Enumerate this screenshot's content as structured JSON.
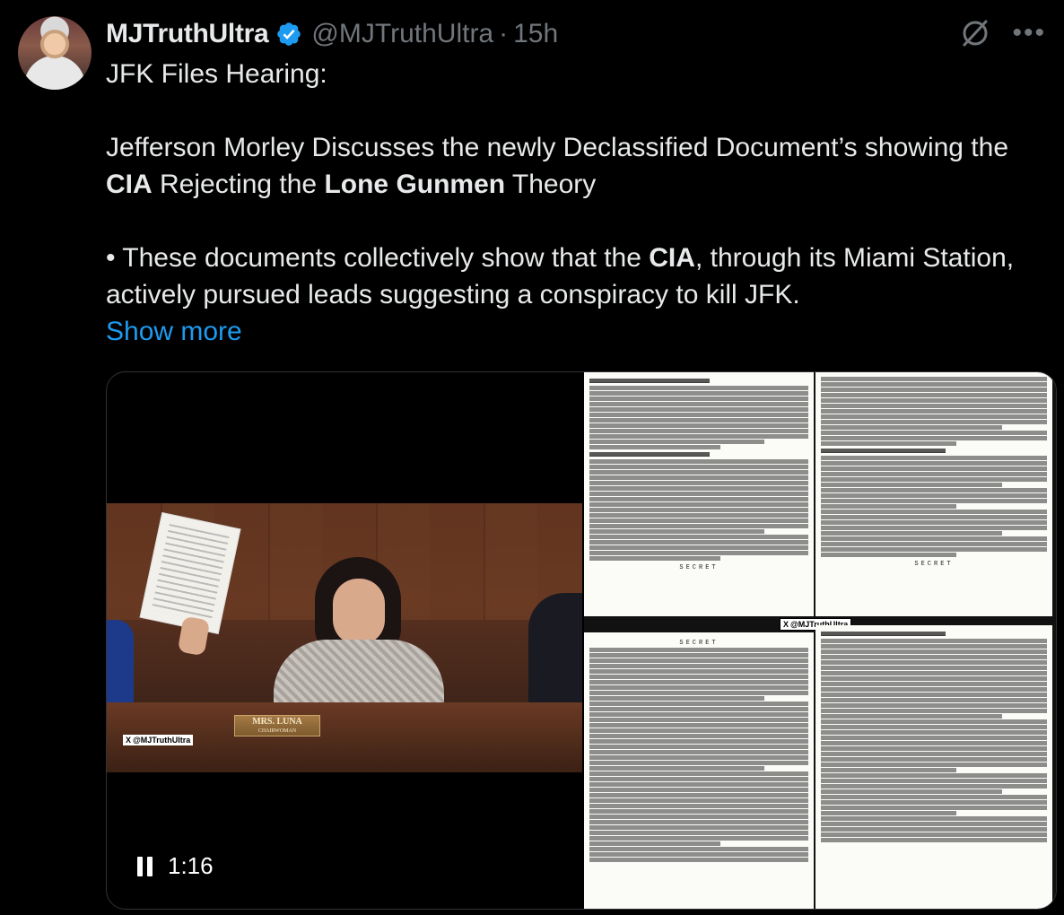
{
  "author": {
    "display_name": "MJTruthUltra",
    "handle": "@MJTruthUltra",
    "separator": "·",
    "time": "15h"
  },
  "tweet": {
    "line1": "JFK Files Hearing:",
    "p2_a": "Jefferson Morley Discusses the newly Declassified Document’s showing the ",
    "p2_b": "CIA",
    "p2_c": " Rejecting the ",
    "p2_d": "Lone Gunmen",
    "p2_e": " Theory",
    "p3_a": "• These documents collectively show that the ",
    "p3_b": "CIA",
    "p3_c": ", through its Miami Station, actively pursued leads suggesting a conspiracy to kill JFK.",
    "show_more": "Show more"
  },
  "media": {
    "nameplate_name": "MRS. LUNA",
    "nameplate_title": "CHAIRWOMAN",
    "watermark": "@MJTruthUltra",
    "watermark_x": "X",
    "doc_secret_1": "SECRET",
    "doc_secret_2": "SECRET",
    "doc_secret_3": "SECRET",
    "time": "1:16"
  },
  "icons": {
    "verified": "verified-badge-icon",
    "grok": "grok-icon",
    "more": "more-icon",
    "pause": "pause-icon"
  },
  "colors": {
    "background": "#000000",
    "text": "#e7e9ea",
    "muted": "#71767b",
    "link": "#1d9bf0",
    "verified": "#1d9bf0"
  }
}
